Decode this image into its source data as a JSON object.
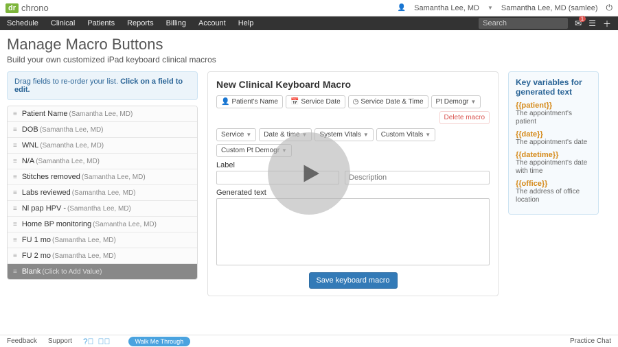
{
  "brand": {
    "box": "dr",
    "text": "chrono"
  },
  "topright": {
    "user1": "Samantha Lee, MD",
    "user2": "Samantha Lee, MD (samlee)"
  },
  "nav": {
    "items": [
      "Schedule",
      "Clinical",
      "Patients",
      "Reports",
      "Billing",
      "Account",
      "Help"
    ],
    "search_placeholder": "Search",
    "badge": "1"
  },
  "page": {
    "title": "Manage Macro Buttons",
    "subtitle": "Build your own customized iPad keyboard clinical macros"
  },
  "hint": {
    "text": "Drag fields to re-order your list. ",
    "bold": "Click on a field to edit."
  },
  "macros": [
    {
      "label": "Patient Name",
      "owner": "(Samantha Lee, MD)"
    },
    {
      "label": "DOB",
      "owner": "(Samantha Lee, MD)"
    },
    {
      "label": "WNL",
      "owner": "(Samantha Lee, MD)"
    },
    {
      "label": "N/A",
      "owner": "(Samantha Lee, MD)"
    },
    {
      "label": "Stitches removed",
      "owner": "(Samantha Lee, MD)"
    },
    {
      "label": "Labs reviewed",
      "owner": "(Samantha Lee, MD)"
    },
    {
      "label": "Nl pap HPV -",
      "owner": "(Samantha Lee, MD)"
    },
    {
      "label": "Home BP monitoring",
      "owner": "(Samantha Lee, MD)"
    },
    {
      "label": "FU 1 mo",
      "owner": "(Samantha Lee, MD)"
    },
    {
      "label": "FU 2 mo",
      "owner": "(Samantha Lee, MD)"
    }
  ],
  "blank": {
    "label": "Blank",
    "owner": "(Click to Add Value)"
  },
  "center": {
    "heading": "New Clinical Keyboard Macro",
    "row1": [
      "Patient's Name",
      "Service Date",
      "Service Date & Time",
      "Pt Demogr"
    ],
    "delete": "Delete macro",
    "row2": [
      "Service",
      "Date & time",
      "System Vitals",
      "Custom Vitals",
      "Custom Pt Demogr"
    ],
    "label_label": "Label",
    "desc_placeholder": "Description",
    "gentext_label": "Generated text",
    "save": "Save keyboard macro"
  },
  "right": {
    "heading": "Key variables for generated text",
    "vars": [
      {
        "name": "{{patient}}",
        "desc": "The appointment's patient"
      },
      {
        "name": "{{date}}",
        "desc": "The appointment's date"
      },
      {
        "name": "{{datetime}}",
        "desc": "The appointment's date with time"
      },
      {
        "name": "{{office}}",
        "desc": "The address of office location"
      }
    ]
  },
  "footer": {
    "feedback": "Feedback",
    "support": "Support",
    "walkme": "Walk Me Through",
    "chat": "Practice Chat"
  }
}
